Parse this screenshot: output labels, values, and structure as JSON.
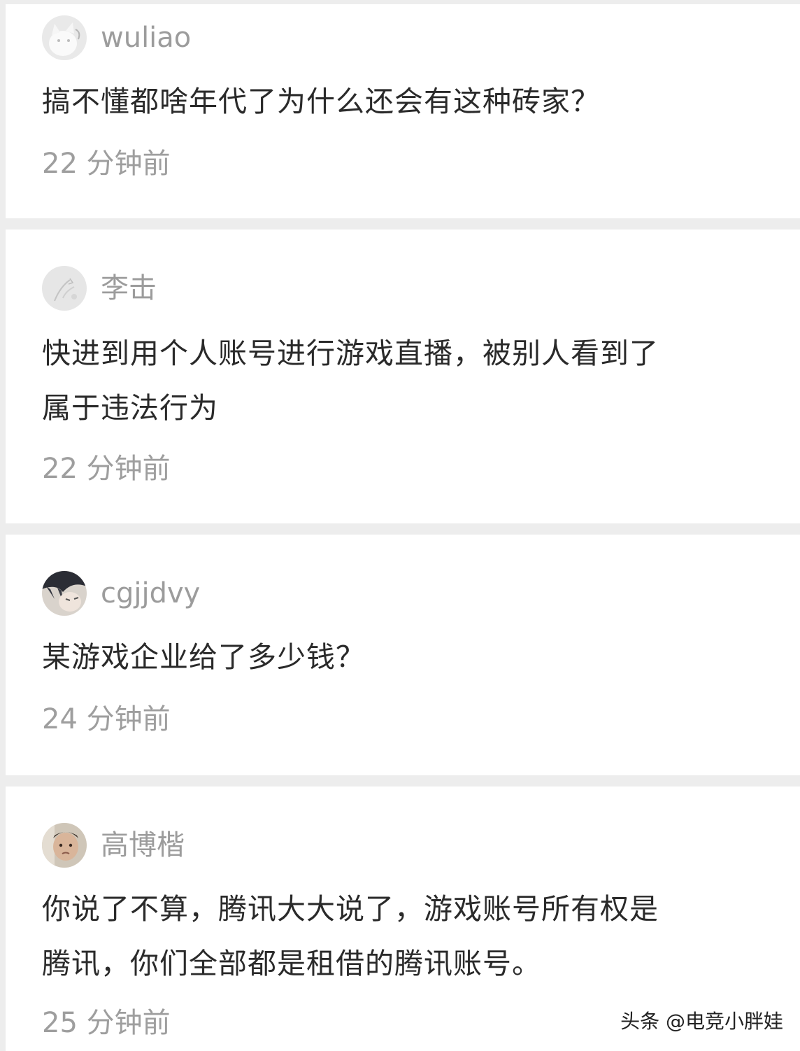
{
  "comments": [
    {
      "username": "wuliao",
      "avatar_icon": "white-cat-avatar-icon",
      "content_lines": [
        "搞不懂都啥年代了为什么还会有这种砖家？"
      ],
      "timestamp": "22 分钟前"
    },
    {
      "username": "李击",
      "avatar_icon": "sketch-avatar-icon",
      "content_lines": [
        "快进到用个人账号进行游戏直播，被别人看到了",
        "属于违法行为"
      ],
      "timestamp": "22 分钟前"
    },
    {
      "username": "cgjjdvy",
      "avatar_icon": "anime-boy-avatar-icon",
      "content_lines": [
        "某游戏企业给了多少钱？"
      ],
      "timestamp": "24 分钟前"
    },
    {
      "username": "高博楷",
      "avatar_icon": "baby-photo-avatar-icon",
      "content_lines": [
        "你说了不算，腾讯大大说了，游戏账号所有权是",
        "腾讯，你们全部都是租借的腾讯账号。"
      ],
      "timestamp": "25 分钟前"
    }
  ],
  "watermark": "头条 @电竞小胖娃"
}
